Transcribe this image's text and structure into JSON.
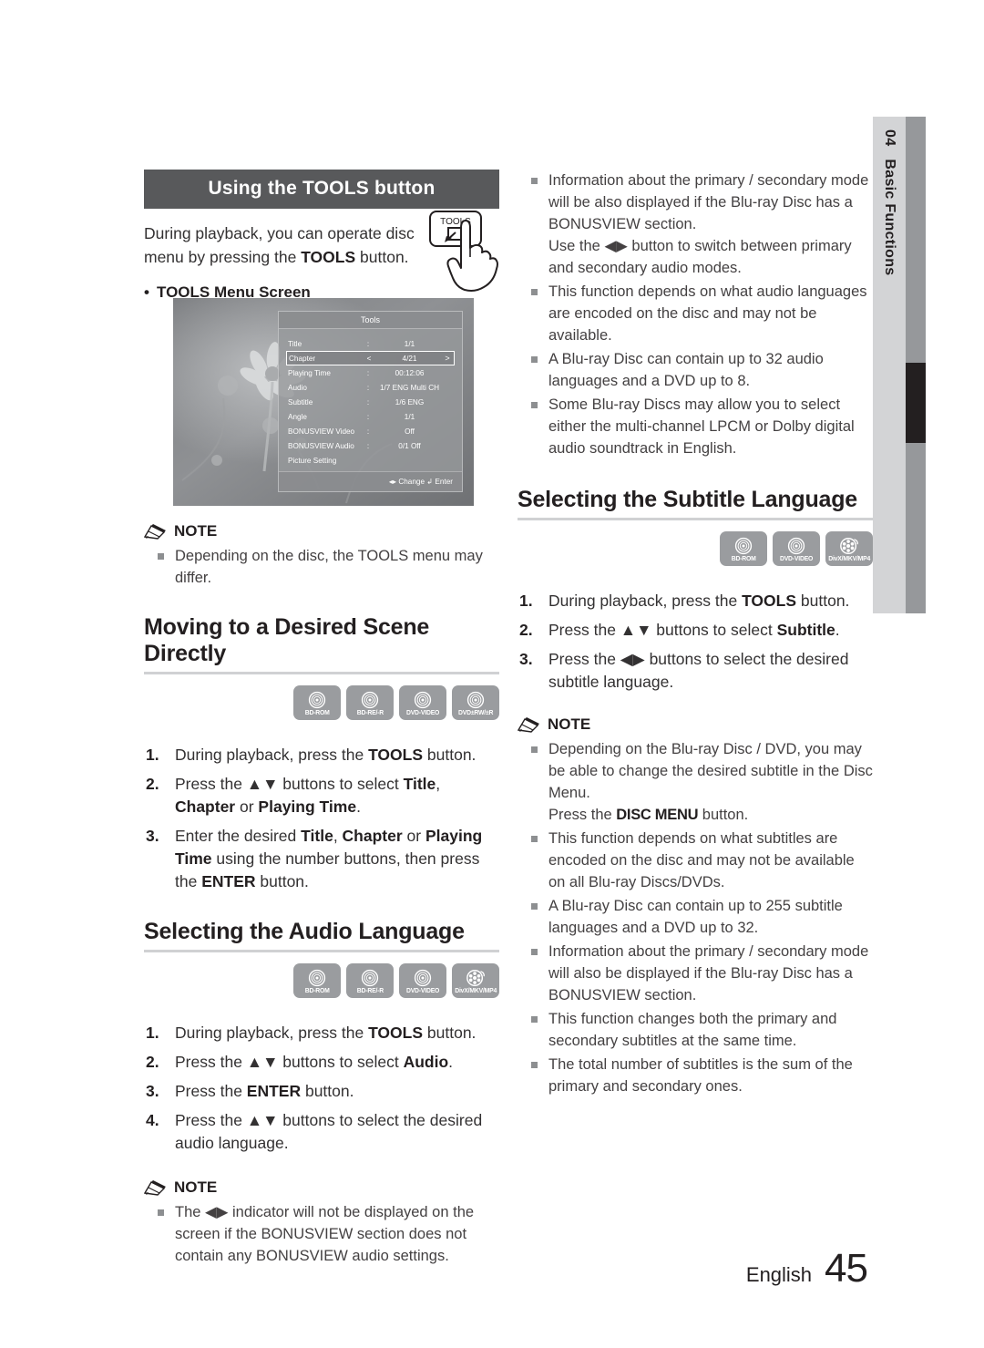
{
  "side_tab": {
    "number": "04",
    "label": "Basic Functions"
  },
  "footer": {
    "language": "English",
    "page": "45"
  },
  "left": {
    "band_title": "Using the TOOLS button",
    "intro_line1": "During playback, you can operate disc",
    "intro_line2_a": "menu by pressing the ",
    "intro_line2_b": "TOOLS",
    "intro_line2_c": " button.",
    "sub_head": "TOOLS Menu Screen",
    "tools_key_label": "TOOLS",
    "osd": {
      "title": "Tools",
      "rows": [
        {
          "label": "Title",
          "sep": ":",
          "value": "1/1",
          "selected": false
        },
        {
          "label": "Chapter",
          "sep": "<",
          "value": "4/21",
          "right": ">",
          "selected": true
        },
        {
          "label": "Playing Time",
          "sep": ":",
          "value": "00:12:06",
          "selected": false
        },
        {
          "label": "Audio",
          "sep": ":",
          "value": "1/7 ENG Multi CH",
          "selected": false
        },
        {
          "label": "Subtitle",
          "sep": ":",
          "value": "1/6 ENG",
          "selected": false
        },
        {
          "label": "Angle",
          "sep": ":",
          "value": "1/1",
          "selected": false
        },
        {
          "label": "BONUSVIEW Video",
          "sep": ":",
          "value": "Off",
          "selected": false
        },
        {
          "label": "BONUSVIEW Audio",
          "sep": ":",
          "value": "0/1 Off",
          "selected": false
        },
        {
          "label": "Picture Setting",
          "sep": "",
          "value": "",
          "selected": false
        }
      ],
      "footer": "◂▸ Change    ↲ Enter"
    },
    "note1_title": "NOTE",
    "note1_items": [
      "Depending on the disc, the TOOLS menu may differ."
    ],
    "scene_heading": "Moving to a Desired Scene Directly",
    "scene_discs": [
      {
        "caption": "BD-ROM",
        "glyph": "disc"
      },
      {
        "caption": "BD-RE/-R",
        "glyph": "disc"
      },
      {
        "caption": "DVD-VIDEO",
        "glyph": "disc"
      },
      {
        "caption": "DVD±RW/±R",
        "glyph": "disc"
      }
    ],
    "scene_steps": [
      {
        "n": "1.",
        "html": "During playback, press the <b>TOOLS</b> button."
      },
      {
        "n": "2.",
        "html": "Press the ▲▼ buttons to select <b>Title</b>, <b>Chapter</b> or <b>Playing Time</b>."
      },
      {
        "n": "3.",
        "html": "Enter the desired <b>Title</b>, <b>Chapter</b> or <b>Playing Time</b> using the number buttons, then press the <b>ENTER</b> button."
      }
    ],
    "audio_heading": "Selecting the Audio Language",
    "audio_discs": [
      {
        "caption": "BD-ROM",
        "glyph": "disc"
      },
      {
        "caption": "BD-RE/-R",
        "glyph": "disc"
      },
      {
        "caption": "DVD-VIDEO",
        "glyph": "disc"
      },
      {
        "caption": "DivX/MKV/MP4",
        "glyph": "film"
      }
    ],
    "audio_steps": [
      {
        "n": "1.",
        "html": "During playback, press the <b>TOOLS</b> button."
      },
      {
        "n": "2.",
        "html": "Press the ▲▼ buttons to select <b>Audio</b>."
      },
      {
        "n": "3.",
        "html": "Press the <b>ENTER</b> button."
      },
      {
        "n": "4.",
        "html": "Press the ▲▼ buttons to select the desired audio language."
      }
    ],
    "note2_title": "NOTE",
    "note2_items": [
      "The ◀▶ indicator will not be displayed on the screen if the BONUSVIEW section does not contain any BONUSVIEW audio settings."
    ]
  },
  "right": {
    "audio_notes": [
      "Information about the primary / secondary mode will be also displayed if the Blu-ray Disc has a BONUSVIEW section.\nUse the ◀▶ button to switch between primary and secondary audio modes.",
      "This function depends on what audio languages are encoded on the disc and may not be available.",
      "A Blu-ray Disc can contain up to 32 audio languages and a DVD up to 8.",
      "Some Blu-ray Discs may allow you to select either the multi-channel LPCM or Dolby digital audio soundtrack in English."
    ],
    "subtitle_heading": "Selecting the Subtitle Language",
    "subtitle_discs": [
      {
        "caption": "BD-ROM",
        "glyph": "disc"
      },
      {
        "caption": "DVD-VIDEO",
        "glyph": "disc"
      },
      {
        "caption": "DivX/MKV/MP4",
        "glyph": "film"
      }
    ],
    "subtitle_steps": [
      {
        "n": "1.",
        "html": "During playback, press the <b>TOOLS</b> button."
      },
      {
        "n": "2.",
        "html": "Press the ▲▼ buttons to select <b>Subtitle</b>."
      },
      {
        "n": "3.",
        "html": "Press the ◀▶ buttons to select the desired subtitle language."
      }
    ],
    "note_title": "NOTE",
    "note_items": [
      "Depending on the Blu-ray Disc / DVD, you may be able to change the desired subtitle in the Disc Menu.\nPress the <span class=\"cond\">DISC MENU</span> button.",
      "This function depends on what subtitles are encoded on the disc and may not be available on all Blu-ray Discs/DVDs.",
      "A Blu-ray Disc can contain up to 255 subtitle languages and a DVD up to 32.",
      "Information about the primary / secondary mode will also be displayed if the Blu-ray Disc has a BONUSVIEW section.",
      "This function changes both the primary and secondary subtitles at the same time.",
      "The total number of subtitles is the sum of the primary and secondary ones."
    ]
  }
}
